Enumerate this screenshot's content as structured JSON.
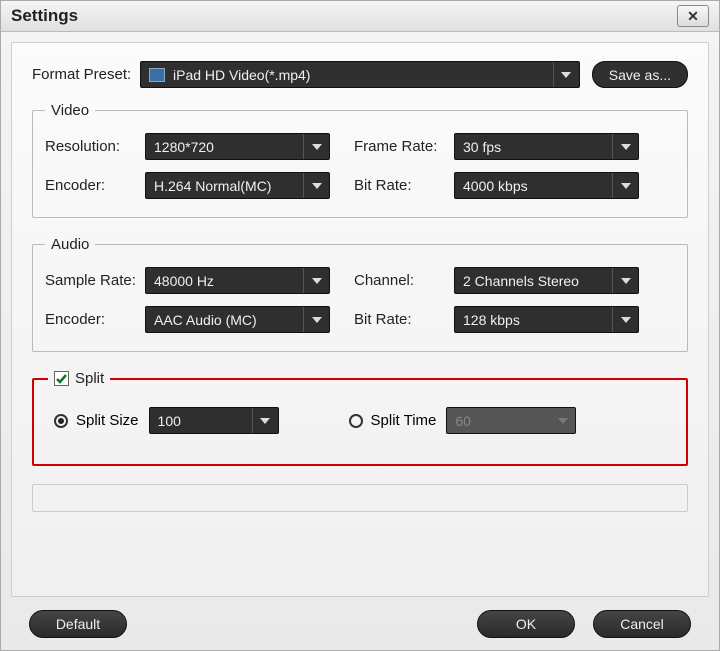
{
  "window": {
    "title": "Settings"
  },
  "format": {
    "label": "Format Preset:",
    "value": "iPad HD Video(*.mp4)",
    "save_label": "Save as..."
  },
  "video": {
    "legend": "Video",
    "resolution_label": "Resolution:",
    "resolution_value": "1280*720",
    "framerate_label": "Frame Rate:",
    "framerate_value": "30 fps",
    "encoder_label": "Encoder:",
    "encoder_value": "H.264 Normal(MC)",
    "bitrate_label": "Bit Rate:",
    "bitrate_value": "4000 kbps"
  },
  "audio": {
    "legend": "Audio",
    "samplerate_label": "Sample Rate:",
    "samplerate_value": "48000 Hz",
    "channel_label": "Channel:",
    "channel_value": "2 Channels Stereo",
    "encoder_label": "Encoder:",
    "encoder_value": "AAC Audio (MC)",
    "bitrate_label": "Bit Rate:",
    "bitrate_value": "128 kbps"
  },
  "split": {
    "legend": "Split",
    "checked": true,
    "size_label": "Split Size",
    "size_value": "100",
    "time_label": "Split Time",
    "time_value": "60"
  },
  "footer": {
    "default_label": "Default",
    "ok_label": "OK",
    "cancel_label": "Cancel"
  }
}
